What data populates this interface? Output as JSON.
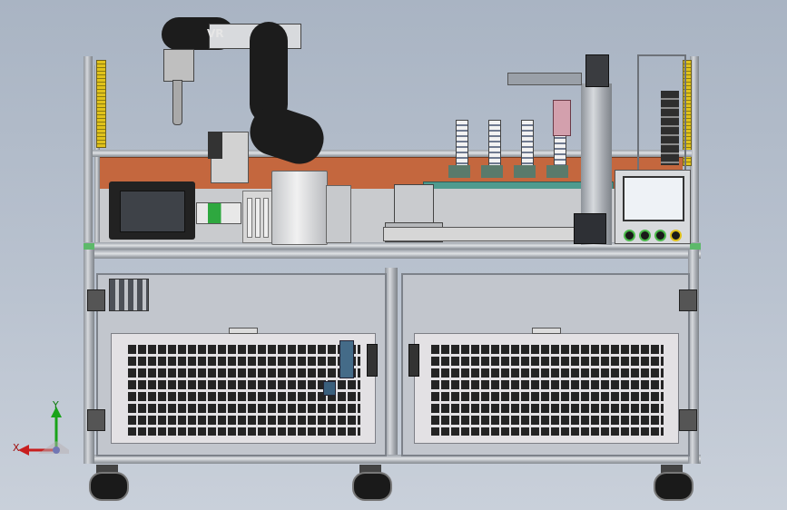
{
  "robot_arm": {
    "brand_text": "VR"
  },
  "coordinate_triad": {
    "y_label": "Y",
    "x_label": "X"
  },
  "colors": {
    "frame": "#b8bcc2",
    "backplate": "#c4673e",
    "green_trim": "#5db96a",
    "robot_body": "#1c1c1c",
    "vent_black": "#242424",
    "axis_y": "#19a319",
    "axis_x": "#c81e1e",
    "axis_z": "#2b3fb5"
  },
  "control_panel": {
    "buttons": [
      "green-button",
      "green-button",
      "green-button",
      "yellow-button"
    ]
  }
}
